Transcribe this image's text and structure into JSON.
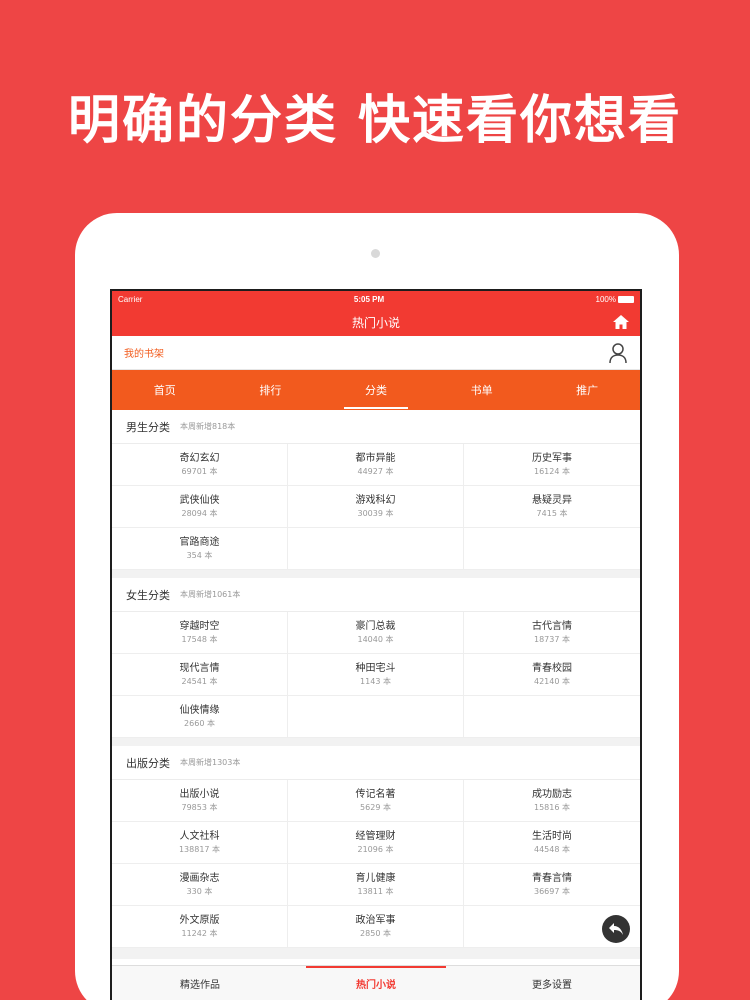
{
  "headline": "明确的分类 快速看你想看",
  "status": {
    "carrier": "Carrier",
    "time": "5:05 PM",
    "battery": "100%"
  },
  "navbar": {
    "title": "热门小说"
  },
  "shelf": {
    "label": "我的书架"
  },
  "tabs": [
    {
      "label": "首页"
    },
    {
      "label": "排行"
    },
    {
      "label": "分类"
    },
    {
      "label": "书单"
    },
    {
      "label": "推广"
    }
  ],
  "sections": {
    "male": {
      "title": "男生分类",
      "sub": "本周新增818本",
      "items": [
        {
          "name": "奇幻玄幻",
          "count": "69701 本"
        },
        {
          "name": "都市异能",
          "count": "44927 本"
        },
        {
          "name": "历史军事",
          "count": "16124 本"
        },
        {
          "name": "武侠仙侠",
          "count": "28094 本"
        },
        {
          "name": "游戏科幻",
          "count": "30039 本"
        },
        {
          "name": "悬疑灵异",
          "count": "7415 本"
        },
        {
          "name": "官路商途",
          "count": "354 本"
        }
      ]
    },
    "female": {
      "title": "女生分类",
      "sub": "本周新增1061本",
      "items": [
        {
          "name": "穿越时空",
          "count": "17548 本"
        },
        {
          "name": "豪门总裁",
          "count": "14040 本"
        },
        {
          "name": "古代言情",
          "count": "18737 本"
        },
        {
          "name": "现代言情",
          "count": "24541 本"
        },
        {
          "name": "种田宅斗",
          "count": "1143 本"
        },
        {
          "name": "青春校园",
          "count": "42140 本"
        },
        {
          "name": "仙侠情缘",
          "count": "2660 本"
        }
      ]
    },
    "publish": {
      "title": "出版分类",
      "sub": "本周新增1303本",
      "items": [
        {
          "name": "出版小说",
          "count": "79853 本"
        },
        {
          "name": "传记名著",
          "count": "5629 本"
        },
        {
          "name": "成功励志",
          "count": "15816 本"
        },
        {
          "name": "人文社科",
          "count": "138817 本"
        },
        {
          "name": "经管理财",
          "count": "21096 本"
        },
        {
          "name": "生活时尚",
          "count": "44548 本"
        },
        {
          "name": "漫画杂志",
          "count": "330 本"
        },
        {
          "name": "育儿健康",
          "count": "13811 本"
        },
        {
          "name": "青春言情",
          "count": "36697 本"
        },
        {
          "name": "外文原版",
          "count": "11242 本"
        },
        {
          "name": "政治军事",
          "count": "2850 本"
        }
      ]
    }
  },
  "bottom_tabs": [
    {
      "label": "精选作品"
    },
    {
      "label": "热门小说"
    },
    {
      "label": "更多设置"
    }
  ],
  "colors": {
    "brand": "#ee4545",
    "accent": "#f25a1e"
  }
}
